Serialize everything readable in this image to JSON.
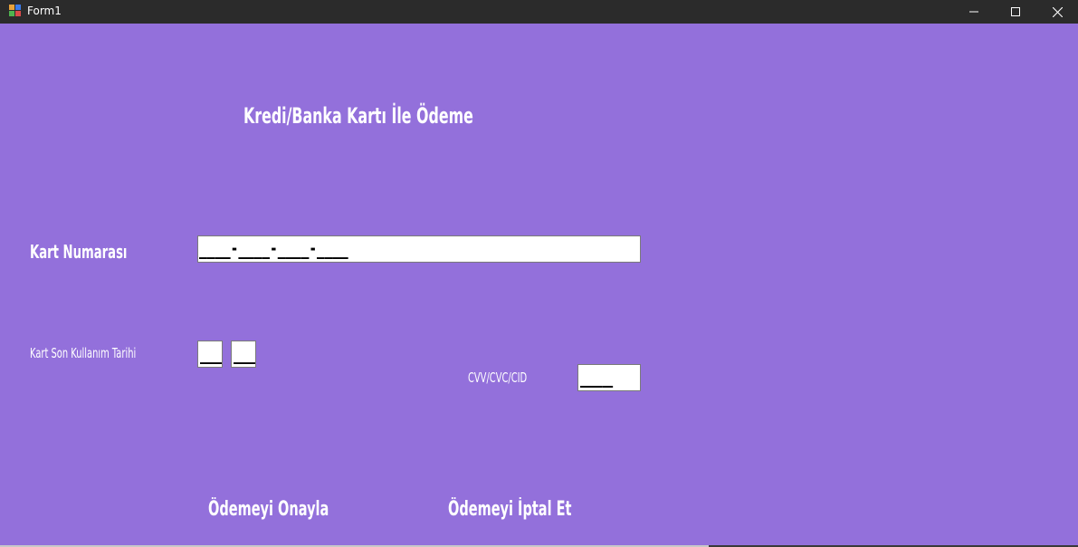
{
  "window": {
    "title": "Form1",
    "minimize_icon": "minimize-icon",
    "maximize_icon": "maximize-icon",
    "close_icon": "close-icon",
    "app_icon": "winforms-app-icon"
  },
  "colors": {
    "background": "#9370DB",
    "titlebar": "#2b2b2b",
    "text": "#ffffff"
  },
  "form": {
    "heading": "Kredi/Banka Kartı İle Ödeme",
    "card_number_label": "Kart Numarası",
    "card_number_value": "____-____-____-____",
    "expiry_label": "Kart Son Kullanım Tarihi",
    "expiry_month_value": "__",
    "expiry_year_value": "__",
    "cvv_label": "CVV/CVC/CID",
    "cvv_value": "___",
    "confirm_button": "Ödemeyi Onayla",
    "cancel_button": "Ödemeyi İptal Et"
  }
}
